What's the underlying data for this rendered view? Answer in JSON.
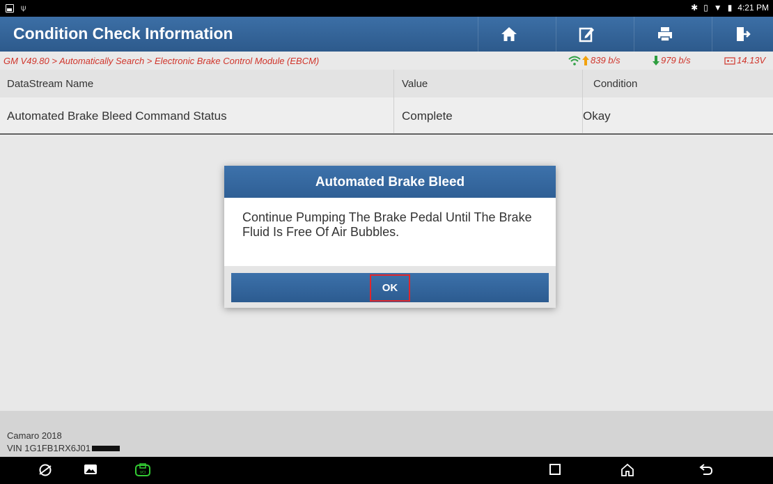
{
  "status_bar": {
    "time": "4:21 PM"
  },
  "header": {
    "title": "Condition Check Information",
    "icons": [
      "home-icon",
      "edit-icon",
      "print-icon",
      "exit-icon"
    ]
  },
  "breadcrumb": {
    "path": "GM V49.80 > Automatically Search > Electronic Brake Control Module (EBCM)",
    "upload": "839 b/s",
    "download": "979 b/s",
    "voltage": "14.13V"
  },
  "table": {
    "columns": [
      "DataStream Name",
      "Value",
      "Condition"
    ],
    "rows": [
      {
        "name": "Automated Brake Bleed Command Status",
        "value": "Complete",
        "condition": "Okay"
      }
    ]
  },
  "footer": {
    "vehicle": "Camaro 2018",
    "vin": "VIN 1G1FB1RX6J01"
  },
  "dialog": {
    "title": "Automated Brake Bleed",
    "message": "Continue Pumping The Brake Pedal Until The Brake Fluid Is Free Of Air Bubbles.",
    "ok_label": "OK"
  },
  "colors": {
    "header_blue": "#2d5a8c",
    "breadcrumb_red": "#d0342a",
    "highlight_red": "#e0262b",
    "download_green": "#2e9e3f",
    "upload_orange": "#f2a20d",
    "wifi_green": "#2ea043"
  }
}
